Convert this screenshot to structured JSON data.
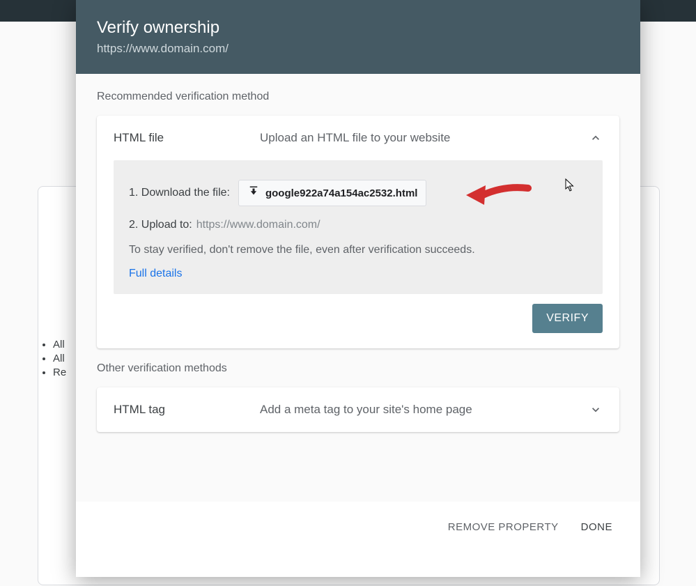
{
  "dialog": {
    "title": "Verify ownership",
    "subtitle": "https://www.domain.com/",
    "recommended_label": "Recommended verification method",
    "other_label": "Other verification methods"
  },
  "html_file_card": {
    "name": "HTML file",
    "desc": "Upload an HTML file to your website",
    "step1_prefix": "1. Download the file:",
    "download_filename": "google922a74a154ac2532.html",
    "step2_prefix": "2. Upload to:",
    "step2_target": "https://www.domain.com/",
    "stay_note": "To stay verified, don't remove the file, even after verification succeeds.",
    "full_details": "Full details",
    "verify_label": "VERIFY"
  },
  "html_tag_card": {
    "name": "HTML tag",
    "desc": "Add a meta tag to your site's home page"
  },
  "footer": {
    "remove": "REMOVE PROPERTY",
    "done": "DONE"
  },
  "background_list": {
    "items": [
      "All",
      "All",
      "Re"
    ]
  }
}
